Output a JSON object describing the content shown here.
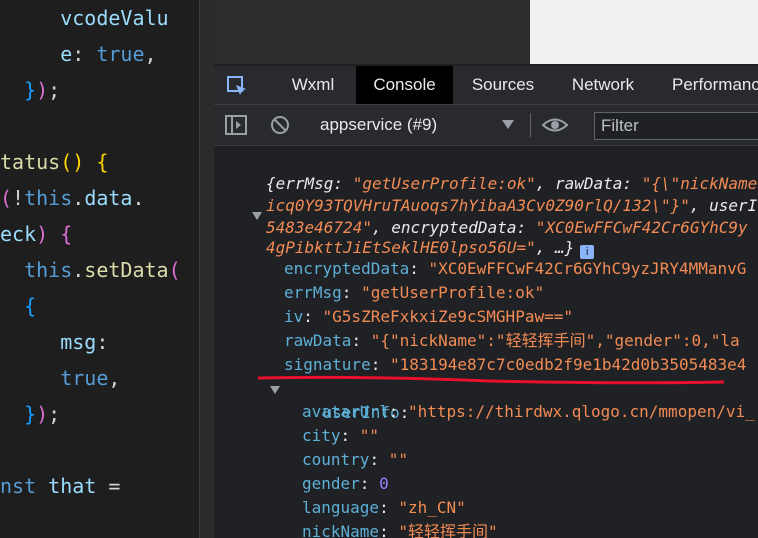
{
  "editor": {
    "lines": [
      {
        "segments": [
          [
            "tok-var",
            "     vcodeValu"
          ]
        ]
      },
      {
        "segments": [
          [
            "tok-var",
            "     e"
          ],
          [
            "tok-op",
            ": "
          ],
          [
            "tok-kw",
            "true"
          ],
          [
            "tok-op",
            ","
          ]
        ]
      },
      {
        "segments": [
          [
            "tok-br3",
            "  }"
          ],
          [
            "tok-br2",
            ")"
          ],
          [
            "tok-op",
            ";"
          ]
        ]
      },
      {
        "segments": []
      },
      {
        "segments": [
          [
            "tok-fn",
            "tatus"
          ],
          [
            "tok-br",
            "()"
          ],
          [
            "tok-op",
            " "
          ],
          [
            "tok-br",
            "{"
          ]
        ]
      },
      {
        "segments": [
          [
            "tok-br2",
            "("
          ],
          [
            "tok-op",
            "!"
          ],
          [
            "tok-kw",
            "this"
          ],
          [
            "tok-op",
            "."
          ],
          [
            "tok-var",
            "data"
          ],
          [
            "tok-op",
            "."
          ]
        ]
      },
      {
        "segments": [
          [
            "tok-var",
            "eck"
          ],
          [
            "tok-br2",
            ")"
          ],
          [
            "tok-op",
            " "
          ],
          [
            "tok-br2",
            "{"
          ]
        ]
      },
      {
        "segments": [
          [
            "tok-kw",
            "  this"
          ],
          [
            "tok-op",
            "."
          ],
          [
            "tok-fn",
            "setData"
          ],
          [
            "tok-br2",
            "("
          ]
        ]
      },
      {
        "segments": [
          [
            "tok-br3",
            "  {"
          ]
        ]
      },
      {
        "segments": [
          [
            "tok-var",
            "     msg"
          ],
          [
            "tok-op",
            ":"
          ]
        ]
      },
      {
        "segments": [
          [
            "tok-kw",
            "     true"
          ],
          [
            "tok-op",
            ","
          ]
        ]
      },
      {
        "segments": [
          [
            "tok-br3",
            "  }"
          ],
          [
            "tok-br2",
            ")"
          ],
          [
            "tok-op",
            ";"
          ]
        ]
      },
      {
        "segments": []
      },
      {
        "segments": [
          [
            "tok-kw",
            "nst"
          ],
          [
            "tok-var",
            " that"
          ],
          [
            "tok-op",
            " ="
          ]
        ]
      }
    ]
  },
  "devtools": {
    "tabs": [
      {
        "label": "Wxml",
        "active": false
      },
      {
        "label": "Console",
        "active": true
      },
      {
        "label": "Sources",
        "active": false
      },
      {
        "label": "Network",
        "active": false
      },
      {
        "label": "Performance",
        "active": false
      }
    ],
    "context": "appservice (#9)",
    "filter_placeholder": "Filter"
  },
  "console": {
    "summary_line1": [
      [
        "i",
        "{errMsg: "
      ],
      [
        "is",
        "\"getUserProfile:ok\""
      ],
      [
        "i",
        ", rawData: "
      ],
      [
        "is",
        "\"{\\\"nickName"
      ]
    ],
    "summary_line2": [
      [
        "is",
        "icq0Y93TQVHruTAuoqs7hYibaA3Cv0Z90rlQ/132\\\"}\""
      ],
      [
        "i",
        ", userI"
      ]
    ],
    "summary_line3": [
      [
        "is",
        "5483e46724\""
      ],
      [
        "i",
        ", encryptedData: "
      ],
      [
        "is",
        "\"XC0EwFFCwF42Cr6GYhC9y"
      ]
    ],
    "summary_line4": [
      [
        "is",
        "4gPibkttJiEtSeklHE0lpso56U=\""
      ],
      [
        "i",
        ", …}"
      ]
    ],
    "info_badge": "i",
    "props": [
      {
        "key": "encryptedData",
        "value": "\"XC0EwFFCwF42Cr6GYhC9yzJRY4MManvG",
        "vclass": "str"
      },
      {
        "key": "errMsg",
        "value": "\"getUserProfile:ok\"",
        "vclass": "str"
      },
      {
        "key": "iv",
        "value": "\"G5sZReFxkxiZe9cSMGHPaw==\"",
        "vclass": "str"
      },
      {
        "key": "rawData",
        "value": "\"{\"nickName\":\"轻轻挥手间\",\"gender\":0,\"la",
        "vclass": "str"
      },
      {
        "key": "signature",
        "value": "\"183194e87c7c0edb2f9e1b42d0b3505483e4",
        "vclass": "str"
      }
    ],
    "userinfo_key": "userInfo",
    "userinfo_props": [
      {
        "key": "avatarUrl",
        "value": "\"https://thirdwx.qlogo.cn/mmopen/vi_",
        "vclass": "str"
      },
      {
        "key": "city",
        "value": "\"\"",
        "vclass": "str"
      },
      {
        "key": "country",
        "value": "\"\"",
        "vclass": "str"
      },
      {
        "key": "gender",
        "value": "0",
        "vclass": "num"
      },
      {
        "key": "language",
        "value": "\"zh_CN\"",
        "vclass": "str"
      },
      {
        "key": "nickName",
        "value": "\"轻轻挥手间\"",
        "vclass": "str"
      }
    ],
    "annotation_color": "#e8102a"
  }
}
